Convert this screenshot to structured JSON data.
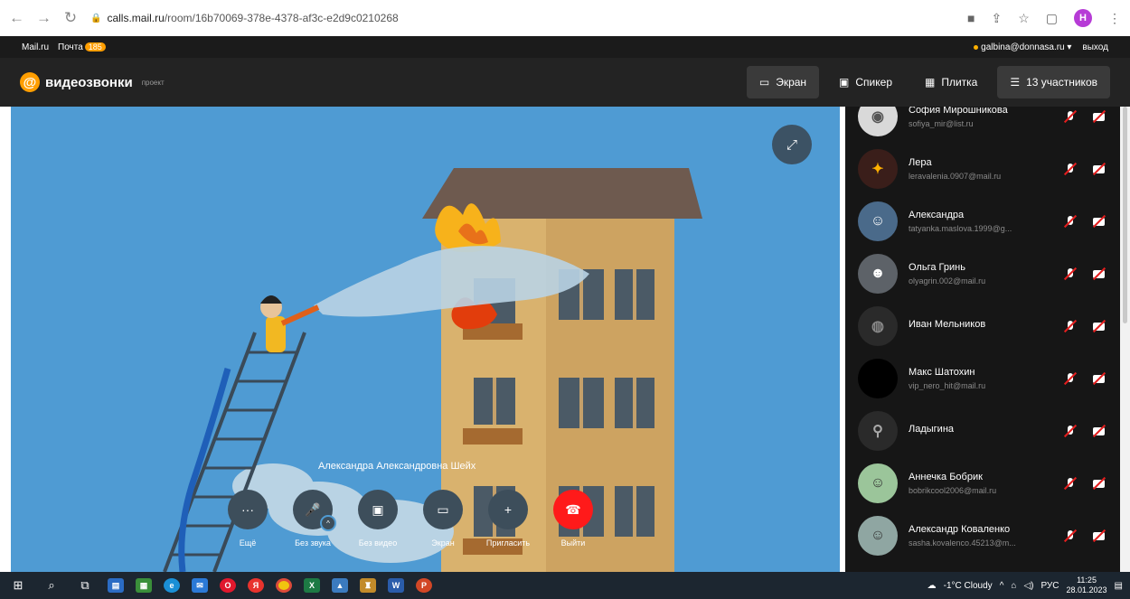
{
  "browser": {
    "url_host": "calls.mail.ru",
    "url_path": "/room/16b70069-378e-4378-af3c-e2d9c0210268",
    "profile_initial": "H"
  },
  "mailbar": {
    "brand": "Mail.ru",
    "mail_label": "Почта",
    "mail_count": "185",
    "user_email": "galbina@donnasa.ru ▾",
    "logout": "выход"
  },
  "app": {
    "logo_text": "видеозвонки",
    "beta_label": "проект",
    "view_buttons": [
      {
        "label": "Экран",
        "icon": "laptop-icon",
        "active": true
      },
      {
        "label": "Спикер",
        "icon": "speaker-view-icon",
        "active": false
      },
      {
        "label": "Плитка",
        "icon": "grid-icon",
        "active": false
      },
      {
        "label": "13 участников",
        "icon": "list-icon",
        "active": true
      }
    ]
  },
  "call": {
    "speaker_name": "Александра Александровна Шейх",
    "controls": [
      {
        "label": "Ещё",
        "icon": "more-icon"
      },
      {
        "label": "Без звука",
        "icon": "mic-off-icon"
      },
      {
        "label": "Без видео",
        "icon": "camera-off-icon"
      },
      {
        "label": "Экран",
        "icon": "screen-share-icon"
      },
      {
        "label": "Пригласить",
        "icon": "plus-icon"
      },
      {
        "label": "Выйти",
        "icon": "hangup-icon"
      }
    ]
  },
  "participants": [
    {
      "name": "София Мирошникова",
      "email": "sofiya_mir@list.ru",
      "avatar_color": "#d9d9d9"
    },
    {
      "name": "Лера",
      "email": "leravalenia.0907@mail.ru",
      "avatar_color": "#3a1e1a"
    },
    {
      "name": "Александра",
      "email": "tatyanka.maslova.1999@g...",
      "avatar_color": "#4a6a8a"
    },
    {
      "name": "Ольга Гринь",
      "email": "olyagrin.002@mail.ru",
      "avatar_color": "#5d6268"
    },
    {
      "name": "Иван Мельников",
      "email": "",
      "avatar_color": "#2a2a2a"
    },
    {
      "name": "Макс Шатохин",
      "email": "vip_nero_hit@mail.ru",
      "avatar_color": "#000000"
    },
    {
      "name": "Ладыгина",
      "email": "",
      "avatar_color": "#2a2a2a"
    },
    {
      "name": "Аннечка Бобрик",
      "email": "bobrikcool2006@mail.ru",
      "avatar_color": "#9bc59a"
    },
    {
      "name": "Александр Коваленко",
      "email": "sasha.kovalenco.45213@m...",
      "avatar_color": "#8fa6a2"
    }
  ],
  "taskbar": {
    "weather": "-1°C Cloudy",
    "lang": "РУС",
    "time": "11:25",
    "date": "28.01.2023"
  }
}
